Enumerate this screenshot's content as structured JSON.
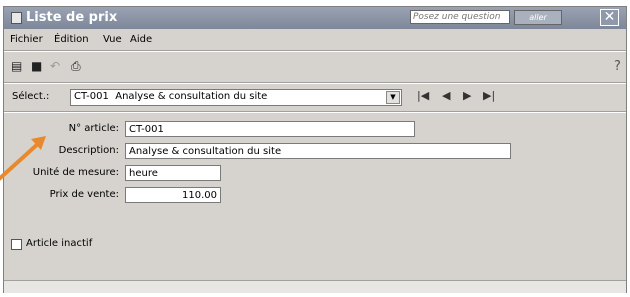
{
  "window": {
    "title": "Liste de prix"
  },
  "ask": {
    "placeholder": "Posez une question",
    "button": "aller"
  },
  "menu": [
    "Fichier",
    "Édition",
    "Vue",
    "Aide"
  ],
  "select": {
    "label": "Sélect.:",
    "value": "CT-001  Analyse & consultation du site"
  },
  "form": {
    "article_label": "N° article:",
    "article_value": "CT-001",
    "description_label": "Description:",
    "description_value": "Analyse & consultation du site",
    "unit_label": "Unité de mesure:",
    "unit_value": "heure",
    "price_label": "Prix de vente:",
    "price_value": "110.00",
    "inactive_label": "Article inactif",
    "inactive_checked": false
  },
  "colors": {
    "arrow": "#e8892e",
    "title_bar": "#8a93a6"
  }
}
